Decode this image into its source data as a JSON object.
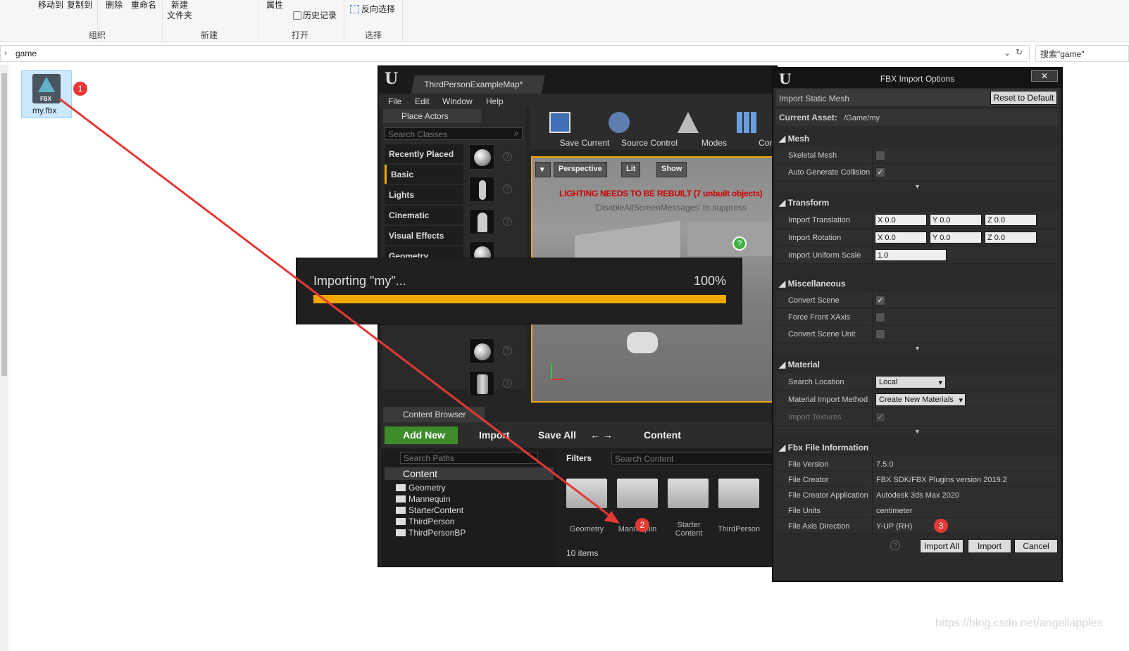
{
  "explorer": {
    "ribbon": {
      "move_to": "移动到",
      "copy_to": "复制到",
      "delete": "删除",
      "rename": "重命名",
      "new_folder_line1": "新建",
      "new_folder_line2": "文件夹",
      "properties": "属性",
      "history": "历史记录",
      "invert_selection": "反向选择",
      "group_organize": "组织",
      "group_new": "新建",
      "group_open": "打开",
      "group_select": "选择"
    },
    "address": "game",
    "search_placeholder": "搜索\"game\"",
    "file_name": "my.fbx",
    "file_badge_text": "FBX"
  },
  "steps": [
    "1",
    "2",
    "3"
  ],
  "ue": {
    "tab_title": "ThirdPersonExampleMap*",
    "menu": [
      "File",
      "Edit",
      "Window",
      "Help"
    ],
    "place_actors_title": "Place Actors",
    "search_classes_placeholder": "Search Classes",
    "categories": [
      "Recently Placed",
      "Basic",
      "Lights",
      "Cinematic",
      "Visual Effects",
      "Geometry"
    ],
    "toolbar": [
      "Save Current",
      "Source Control",
      "Modes",
      "Content"
    ],
    "viewport": {
      "perspective": "Perspective",
      "lit": "Lit",
      "show": "Show",
      "warning": "LIGHTING NEEDS TO BE REBUILT (7 unbuilt objects)",
      "warning_sub": "'DisableAllScreenMessages' to suppress"
    },
    "content_browser": {
      "title": "Content Browser",
      "add_new": "Add New",
      "import": "Import",
      "save_all": "Save All",
      "crumb": "Content",
      "search_paths": "Search Paths",
      "filters": "Filters",
      "search_content": "Search Content",
      "tree_root": "Content",
      "tree": [
        "Geometry",
        "Mannequin",
        "StarterContent",
        "ThirdPerson",
        "ThirdPersonBP"
      ],
      "assets": [
        "Geometry",
        "Mannequin",
        "Starter Content",
        "ThirdPerson"
      ],
      "item_count": "10 items"
    }
  },
  "progress": {
    "title": "Importing \"my\"...",
    "percent_label": "100%",
    "fraction": 1.0
  },
  "fbx": {
    "title": "FBX Import Options",
    "close": "✕",
    "header": "Import Static Mesh",
    "reset": "Reset to Default",
    "current_asset_label": "Current Asset:",
    "current_asset": "/Game/my",
    "sections": {
      "mesh": "Mesh",
      "transform": "Transform",
      "misc": "Miscellaneous",
      "material": "Material",
      "info": "Fbx File Information"
    },
    "mesh": {
      "skeletal_mesh": "Skeletal Mesh",
      "auto_collision": "Auto Generate Collision"
    },
    "transform": {
      "translation": "Import Translation",
      "rotation": "Import Rotation",
      "uniform_scale": "Import Uniform Scale",
      "tx": "X 0.0",
      "ty": "Y 0.0",
      "tz": "Z 0.0",
      "rx": "X 0.0",
      "ry": "Y 0.0",
      "rz": "Z 0.0",
      "scale": "1.0"
    },
    "misc": {
      "convert_scene": "Convert Scene",
      "force_front": "Force Front XAxis",
      "convert_unit": "Convert Scene Unit"
    },
    "material": {
      "search_location": "Search Location",
      "search_location_value": "Local",
      "method": "Material Import Method",
      "method_value": "Create New Materials",
      "import_textures": "Import Textures"
    },
    "info": {
      "version_label": "File Version",
      "version": "7.5.0",
      "creator_label": "File Creator",
      "creator": "FBX SDK/FBX Plugins version 2019.2",
      "app_label": "File Creator Application",
      "app": "Autodesk 3ds Max 2020",
      "units_label": "File Units",
      "units": "centimeter",
      "axis_label": "File Axis Direction",
      "axis": "Y-UP (RH)"
    },
    "buttons": {
      "import_all": "Import All",
      "import": "Import",
      "cancel": "Cancel"
    }
  },
  "watermark": "https://blog.csdn.net/angellapples",
  "colors": {
    "accent": "#f0a700",
    "arrow": "#e53935",
    "add_new": "#3d8b2a"
  }
}
